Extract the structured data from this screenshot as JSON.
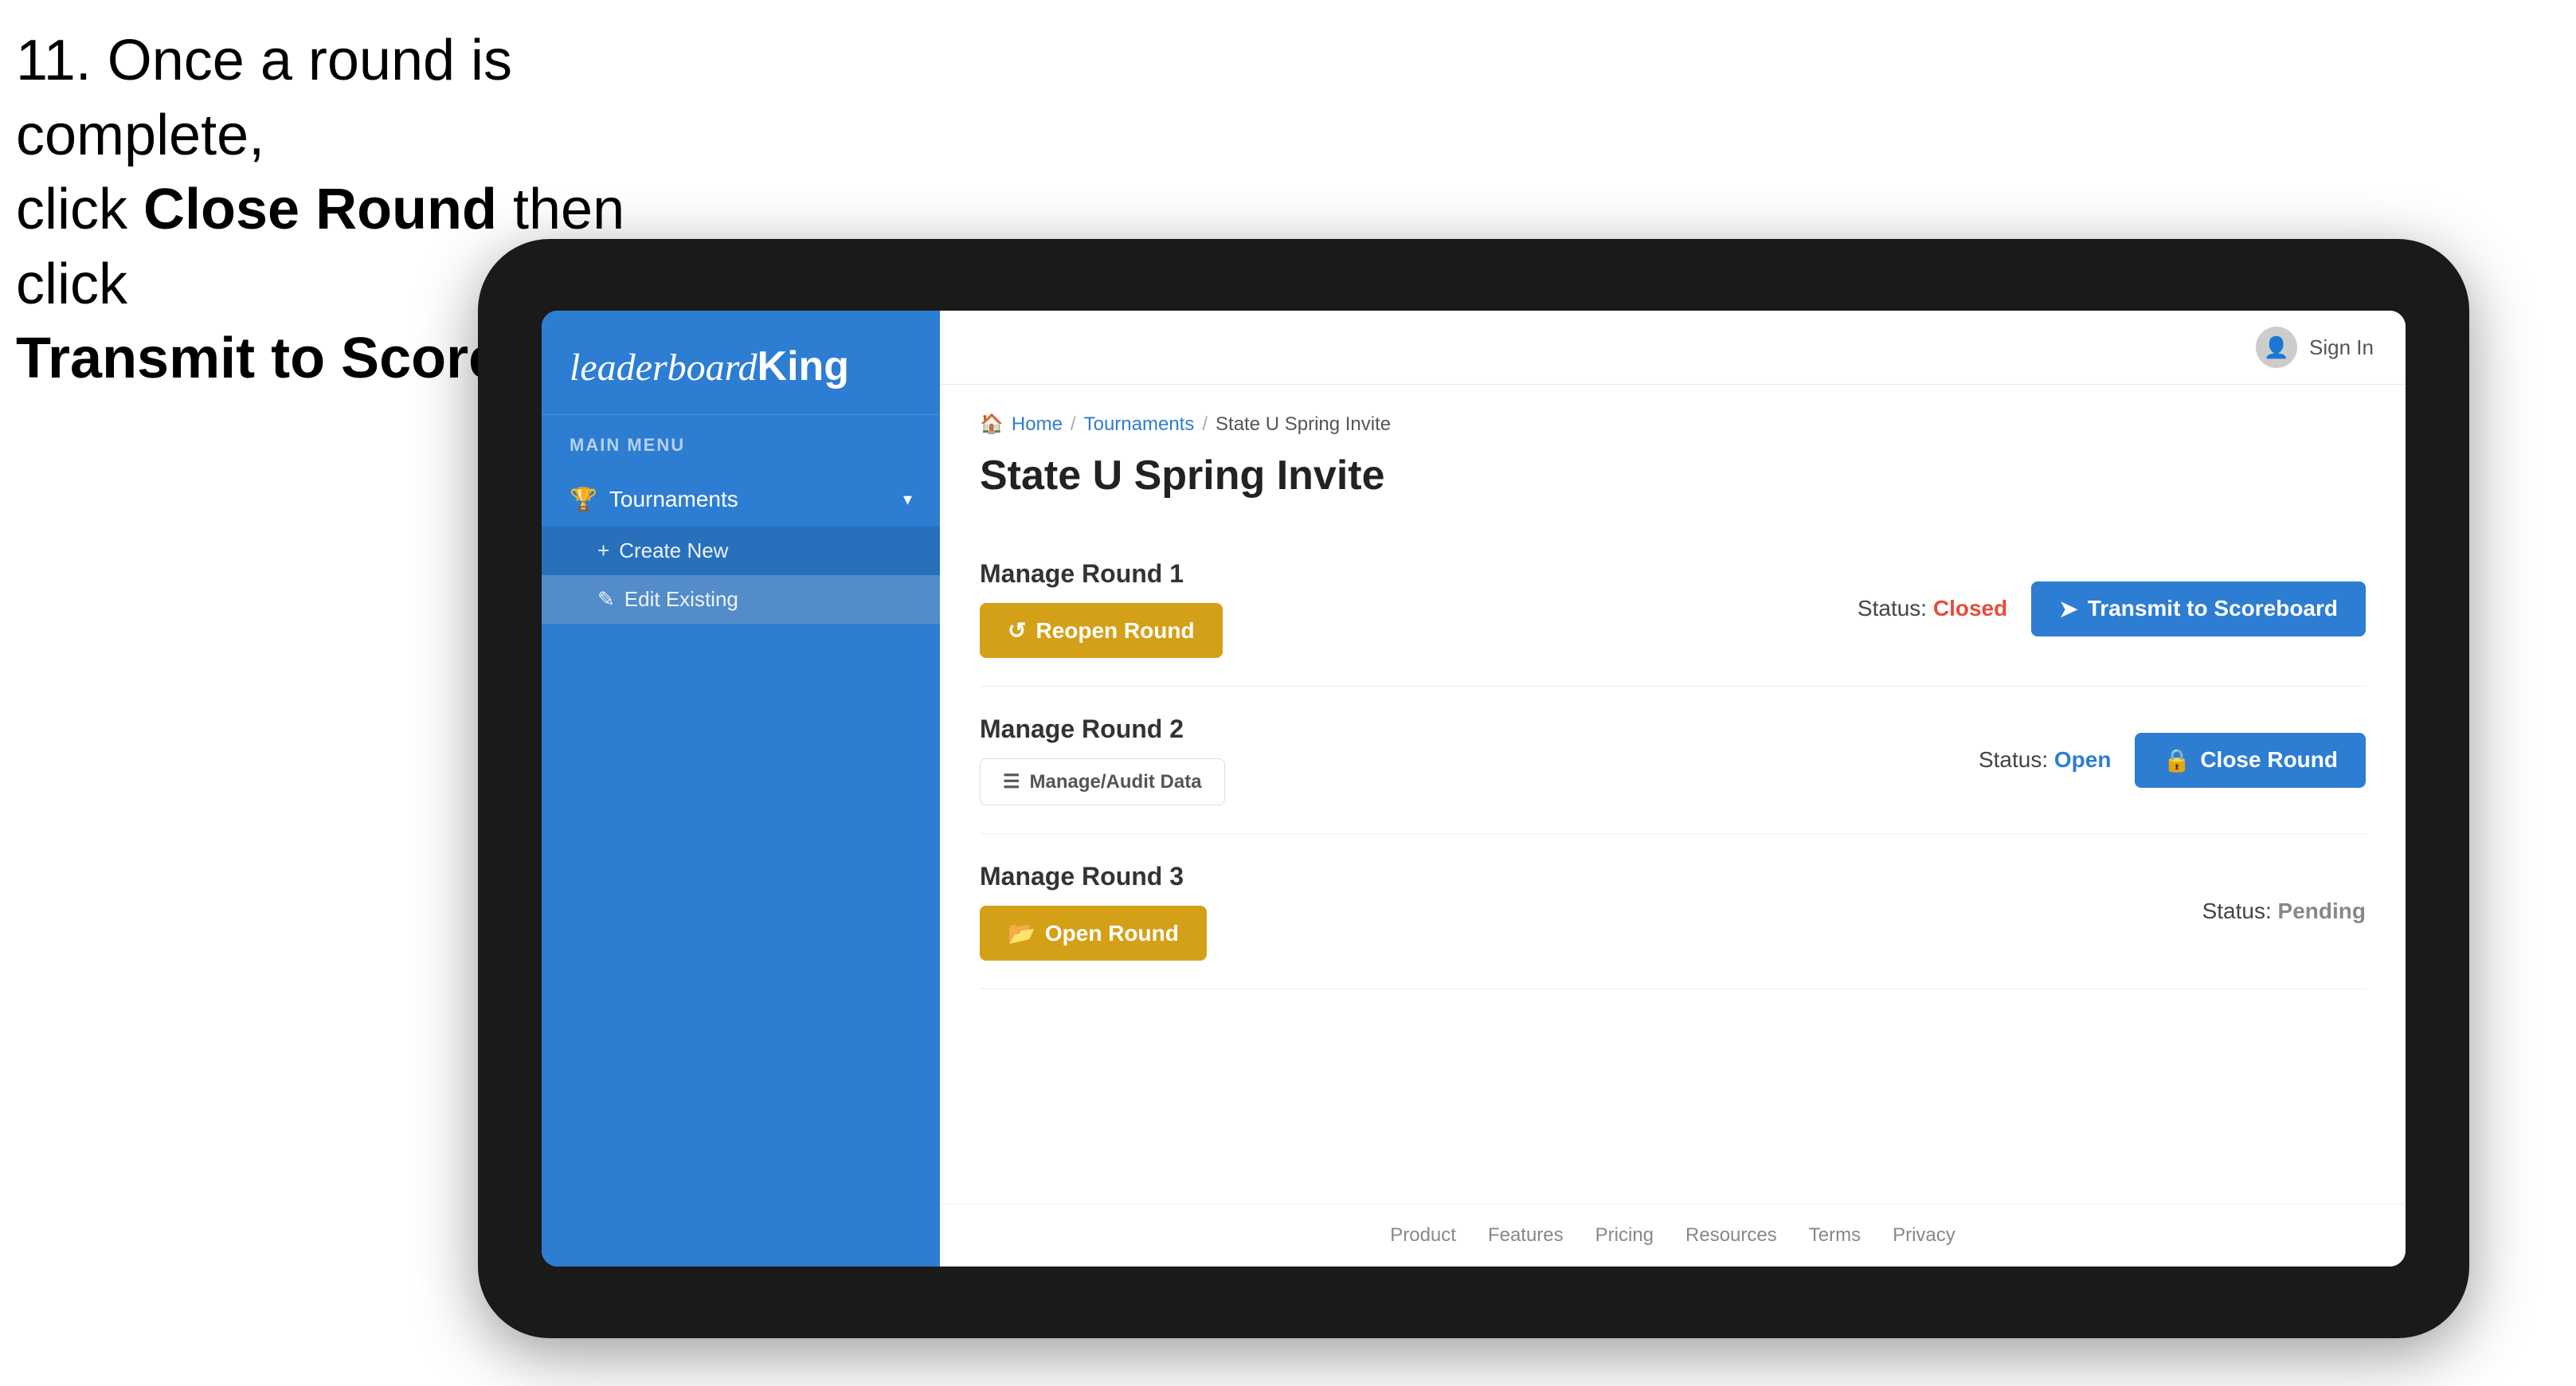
{
  "instruction": {
    "line1": "11. Once a round is complete,",
    "line2": "click ",
    "bold1": "Close Round",
    "line3": " then click",
    "bold2": "Transmit to Scoreboard."
  },
  "logo": {
    "leaderboard": "leaderboard",
    "king": "King"
  },
  "sidebar": {
    "main_menu_label": "MAIN MENU",
    "nav_items": [
      {
        "label": "Tournaments",
        "icon": "🏆",
        "has_chevron": true
      }
    ],
    "sub_items": [
      {
        "label": "Create New",
        "icon": "+"
      },
      {
        "label": "Edit Existing",
        "icon": "✎",
        "active": true
      }
    ]
  },
  "topbar": {
    "sign_in": "Sign In"
  },
  "breadcrumb": {
    "home": "Home",
    "tournaments": "Tournaments",
    "current": "State U Spring Invite"
  },
  "page": {
    "title": "State U Spring Invite",
    "rounds": [
      {
        "title": "Manage Round 1",
        "status_label": "Status:",
        "status_value": "Closed",
        "status_class": "status-closed",
        "primary_button": "Reopen Round",
        "primary_btn_class": "btn-gold",
        "secondary_button": "Transmit to Scoreboard",
        "secondary_btn_class": "btn-blue"
      },
      {
        "title": "Manage Round 2",
        "status_label": "Status:",
        "status_value": "Open",
        "status_class": "status-open",
        "audit_button": "Manage/Audit Data",
        "primary_button": "Close Round",
        "primary_btn_class": "btn-blue"
      },
      {
        "title": "Manage Round 3",
        "status_label": "Status:",
        "status_value": "Pending",
        "status_class": "status-pending",
        "primary_button": "Open Round",
        "primary_btn_class": "btn-gold"
      }
    ]
  },
  "footer": {
    "links": [
      "Product",
      "Features",
      "Pricing",
      "Resources",
      "Terms",
      "Privacy"
    ]
  }
}
